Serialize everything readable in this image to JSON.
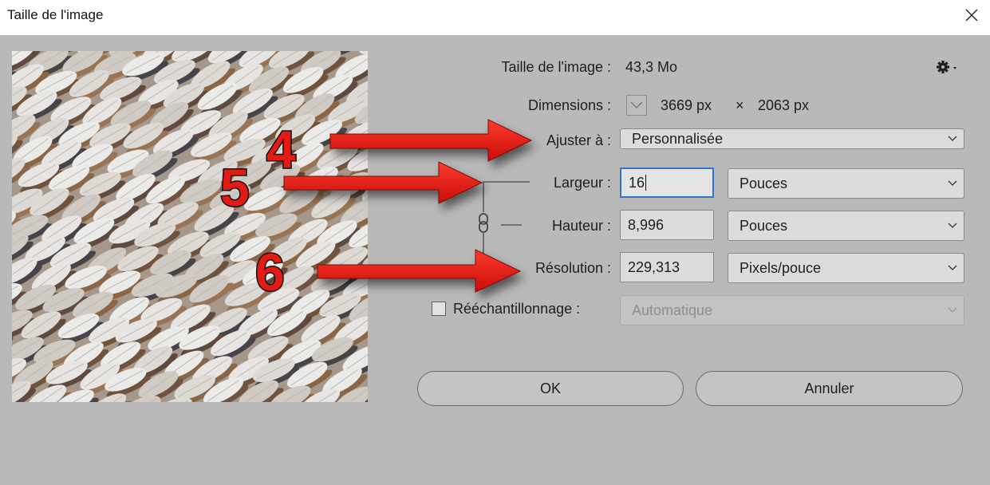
{
  "window": {
    "title": "Taille de l'image"
  },
  "info": {
    "size_label": "Taille de l'image :",
    "size_value": "43,3 Mo",
    "dimensions_label": "Dimensions :",
    "width_px": "3669 px",
    "times": "×",
    "height_px": "2063 px"
  },
  "fit": {
    "label": "Ajuster à :",
    "value": "Personnalisée"
  },
  "width": {
    "label": "Largeur :",
    "value": "16",
    "unit": "Pouces"
  },
  "height": {
    "label": "Hauteur :",
    "value": "8,996",
    "unit": "Pouces"
  },
  "resolution": {
    "label": "Résolution :",
    "value": "229,313",
    "unit": "Pixels/pouce"
  },
  "resample": {
    "label": "Rééchantillonnage :",
    "checked": false,
    "value": "Automatique"
  },
  "buttons": {
    "ok": "OK",
    "cancel": "Annuler"
  },
  "annotations": {
    "step_a": "4",
    "step_b": "5",
    "step_c": "6",
    "arrow_color": "#e31b14"
  },
  "icons": {
    "close": "close-icon",
    "gear": "gear-icon",
    "link": "chain-link-icon",
    "chevron": "chevron-down-icon"
  },
  "colors": {
    "accent_focus": "#2f74c8",
    "dialog_bg": "#b9b9b9"
  }
}
